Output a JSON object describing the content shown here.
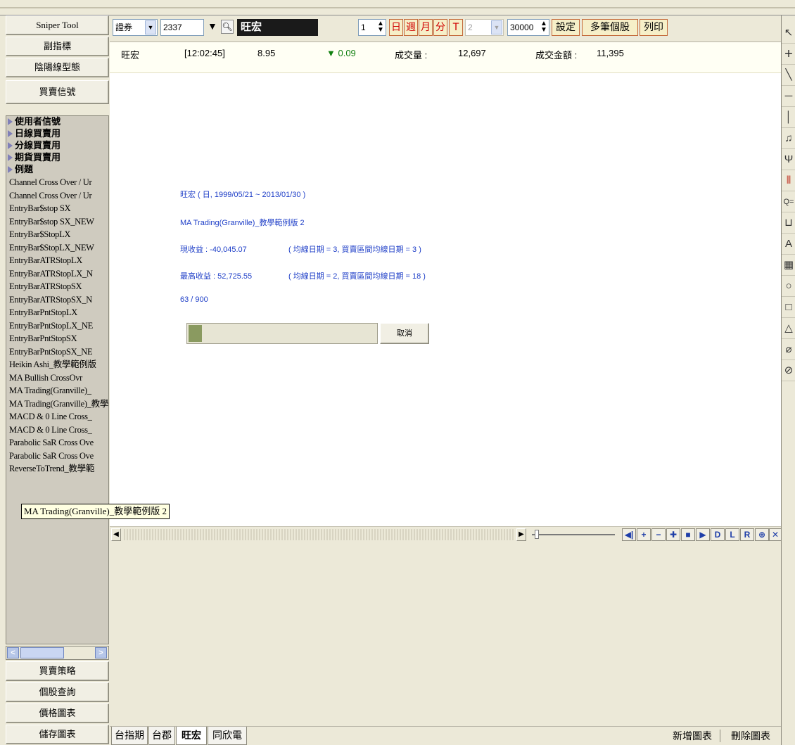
{
  "left_panel": {
    "top_buttons": [
      "Sniper Tool",
      "副指標",
      "陰陽線型態",
      "買賣信號"
    ],
    "folders": [
      "使用者信號",
      "日線買賣用",
      "分線買賣用",
      "期貨買賣用",
      "例題"
    ],
    "items": [
      "Channel Cross Over / Ur",
      "Channel Cross Over / Ur",
      "EntryBar$stop SX",
      "EntryBar$stop SX_NEW",
      "EntryBar$StopLX",
      "EntryBar$StopLX_NEW",
      "EntryBarATRStopLX",
      "EntryBarATRStopLX_N",
      "EntryBarATRStopSX",
      "EntryBarATRStopSX_N",
      "EntryBarPntStopLX",
      "EntryBarPntStopLX_NE",
      "EntryBarPntStopSX",
      "EntryBarPntStopSX_NE",
      "Heikin Ashi_教學範例版",
      "MA Bullish CrossOvr",
      "MA Trading(Granville)_",
      "MA Trading(Granville)_教學範例版 2",
      "MACD & 0 Line Cross_",
      "MACD & 0 Line Cross_",
      "Parabolic SaR Cross Ove",
      "Parabolic SaR Cross Ove",
      "ReverseToTrend_教學範"
    ],
    "tooltip": "MA Trading(Granville)_教學範例版 2",
    "bottom_buttons": [
      "買賣策略",
      "個股查詢",
      "價格圖表",
      "儲存圖表"
    ]
  },
  "toolbar": {
    "market_select": "證券",
    "stock_code": "2337",
    "stock_name": "旺宏",
    "period_value": "1",
    "period_buttons": [
      "日",
      "週",
      "月",
      "分",
      "T"
    ],
    "tick_value": "2",
    "count_value": "30000",
    "settings_label": "設定",
    "multi_stock_label": "多筆個股",
    "print_label": "列印"
  },
  "quote": {
    "name": "旺宏",
    "time": "[12:02:45]",
    "price": "8.95",
    "change": "▼ 0.09",
    "volume_label": "成交量 :",
    "volume": "12,697",
    "amount_label": "成交金額 :",
    "amount": "11,395"
  },
  "progress_panel": {
    "line1": "旺宏 ( 日, 1999/05/21 ~ 2013/01/30 )",
    "line2": "MA Trading(Granville)_教學範例版 2",
    "line3_a": "現收益 : -40,045.07",
    "line3_b": "( 均線日期 = 3, 買賣區間均線日期 = 3 )",
    "line4_a": "最高收益 : 52,725.55",
    "line4_b": "( 均線日期 = 2, 買賣區間均線日期 = 18 )",
    "counter": "63 / 900",
    "progress_fraction": 0.07,
    "cancel_label": "取消"
  },
  "chart_nav": [
    "D",
    "L",
    "R"
  ],
  "tabs": [
    "台指期",
    "台郡",
    "旺宏",
    "同欣電"
  ],
  "active_tab": "旺宏",
  "chart_actions": [
    "新增圖表",
    "刪除圖表"
  ],
  "colors": {
    "accent_red": "#d00000",
    "progress_text": "#2040c8",
    "down_green": "#108010"
  }
}
